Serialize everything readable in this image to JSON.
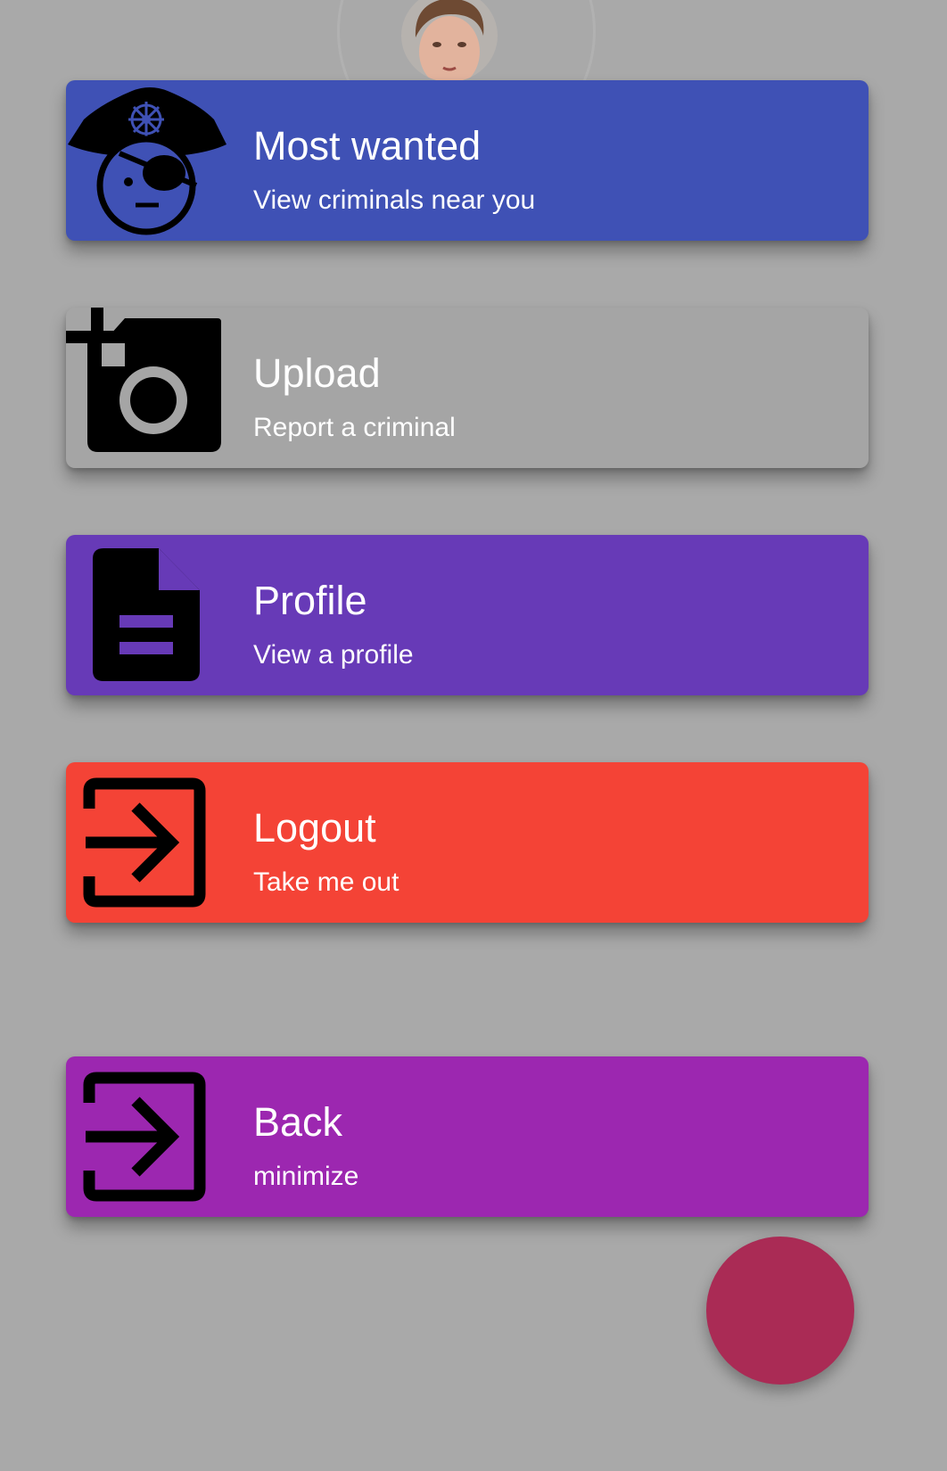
{
  "colors": {
    "background": "#a9a9a9",
    "fab": "#aa2b55"
  },
  "menu": {
    "most_wanted": {
      "title": "Most wanted",
      "subtitle": "View criminals near you",
      "color": "#3f51b5",
      "icon": "pirate-icon"
    },
    "upload": {
      "title": "Upload",
      "subtitle": "Report a criminal",
      "color": "#a5a5a5",
      "icon": "add-camera-icon"
    },
    "profile": {
      "title": "Profile",
      "subtitle": "View a profile",
      "color": "#673ab7",
      "icon": "document-icon"
    },
    "logout": {
      "title": "Logout",
      "subtitle": "Take me out",
      "color": "#f44336",
      "icon": "login-arrow-icon"
    },
    "back": {
      "title": "Back",
      "subtitle": "minimize",
      "color": "#9c27b0",
      "icon": "login-arrow-icon"
    }
  }
}
